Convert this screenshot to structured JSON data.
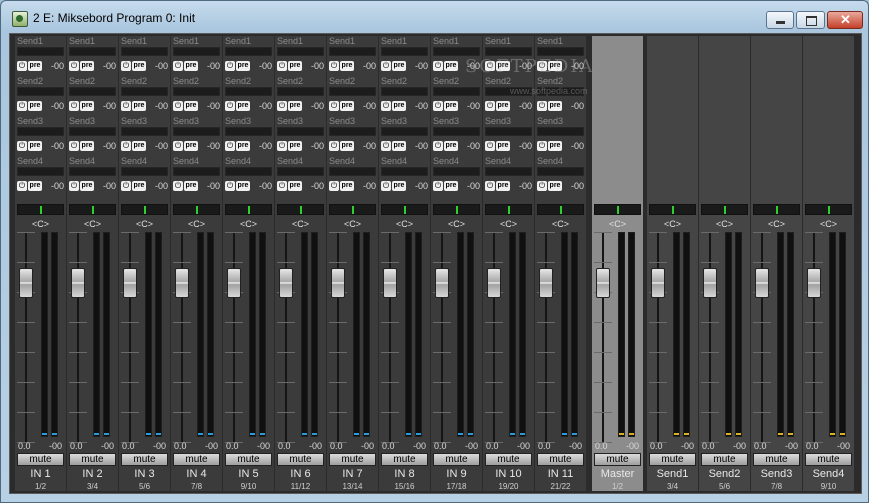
{
  "window": {
    "title": "2 E: Miksebord Program 0: Init"
  },
  "watermark": {
    "main": "SOFTPEDIA",
    "sub": "www.softpedia.com"
  },
  "help_glyph": "?",
  "labels": {
    "pan": "<C>",
    "mute": "mute",
    "pwr": "⏻",
    "pre": "pre"
  },
  "send_names": [
    "Send1",
    "Send2",
    "Send3",
    "Send4"
  ],
  "send_value": "-00",
  "input_channels": [
    {
      "name": "IN 1",
      "sub": "1/2",
      "lvl_l": "0.0",
      "lvl_r": "-00"
    },
    {
      "name": "IN 2",
      "sub": "3/4",
      "lvl_l": "0.0",
      "lvl_r": "-00"
    },
    {
      "name": "IN 3",
      "sub": "5/6",
      "lvl_l": "0.0",
      "lvl_r": "-00"
    },
    {
      "name": "IN 4",
      "sub": "7/8",
      "lvl_l": "0.0",
      "lvl_r": "-00"
    },
    {
      "name": "IN 5",
      "sub": "9/10",
      "lvl_l": "0.0",
      "lvl_r": "-00"
    },
    {
      "name": "IN 6",
      "sub": "11/12",
      "lvl_l": "0.0",
      "lvl_r": "-00"
    },
    {
      "name": "IN 7",
      "sub": "13/14",
      "lvl_l": "0.0",
      "lvl_r": "-00"
    },
    {
      "name": "IN 8",
      "sub": "15/16",
      "lvl_l": "0.0",
      "lvl_r": "-00"
    },
    {
      "name": "IN 9",
      "sub": "17/18",
      "lvl_l": "0.0",
      "lvl_r": "-00"
    },
    {
      "name": "IN 10",
      "sub": "19/20",
      "lvl_l": "0.0",
      "lvl_r": "-00"
    },
    {
      "name": "IN 11",
      "sub": "21/22",
      "lvl_l": "0.0",
      "lvl_r": "-00"
    }
  ],
  "master": {
    "name": "Master",
    "sub": "1/2",
    "lvl_l": "0.0",
    "lvl_r": "-00"
  },
  "send_buses": [
    {
      "name": "Send1",
      "sub": "3/4",
      "lvl_l": "0.0",
      "lvl_r": "-00"
    },
    {
      "name": "Send2",
      "sub": "5/6",
      "lvl_l": "0.0",
      "lvl_r": "-00"
    },
    {
      "name": "Send3",
      "sub": "7/8",
      "lvl_l": "0.0",
      "lvl_r": "-00"
    },
    {
      "name": "Send4",
      "sub": "9/10",
      "lvl_l": "0.0",
      "lvl_r": "-00"
    }
  ]
}
